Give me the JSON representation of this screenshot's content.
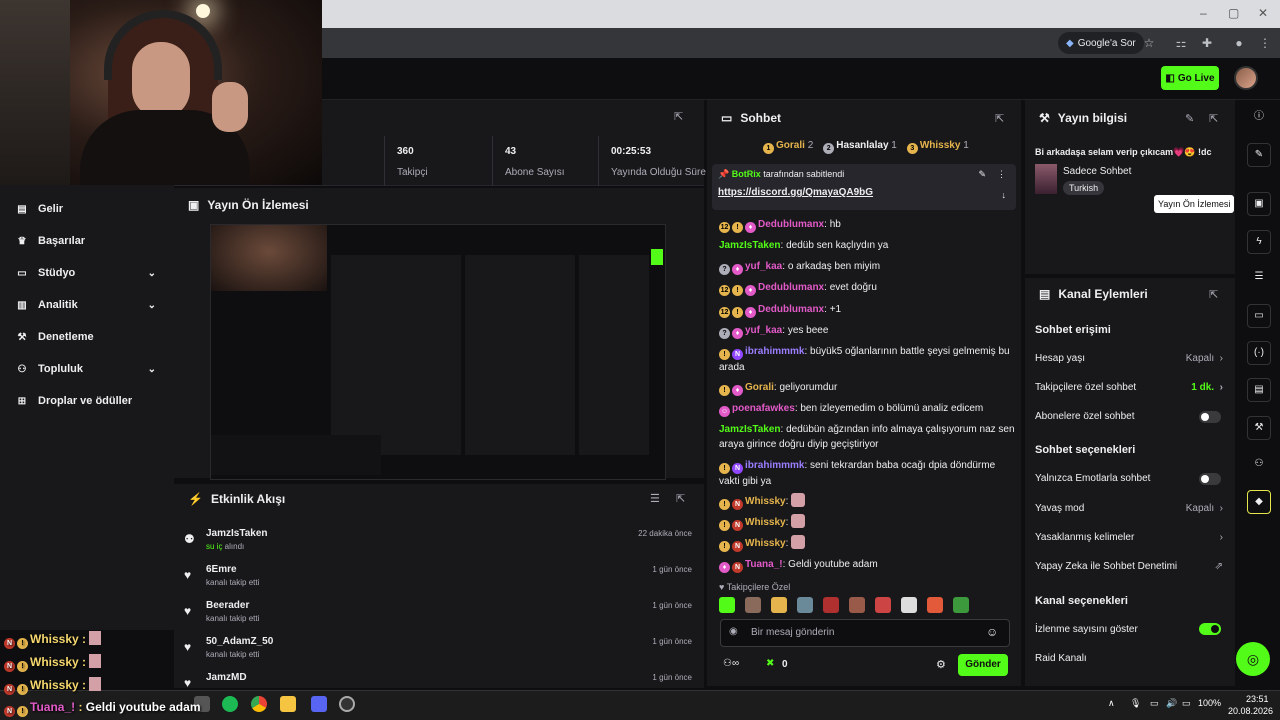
{
  "browser": {
    "google_chip": "Google'a Sor"
  },
  "header": {
    "go_live": "Go Live"
  },
  "sidebar": {
    "items": [
      {
        "label": "Gelir",
        "icon": "money-icon",
        "chevron": false
      },
      {
        "label": "Başarılar",
        "icon": "trophy-icon",
        "chevron": false
      },
      {
        "label": "Stüdyo",
        "icon": "studio-icon",
        "chevron": true
      },
      {
        "label": "Analitik",
        "icon": "chart-icon",
        "chevron": true
      },
      {
        "label": "Denetleme",
        "icon": "wrench-icon",
        "chevron": false
      },
      {
        "label": "Topluluk",
        "icon": "community-icon",
        "chevron": true
      },
      {
        "label": "Droplar ve ödüller",
        "icon": "gift-icon",
        "chevron": false
      }
    ]
  },
  "stats": [
    {
      "value": "360",
      "label": "Takipçi"
    },
    {
      "value": "43",
      "label": "Abone Sayısı"
    },
    {
      "value": "00:25:53",
      "label": "Yayında Olduğu Süre"
    }
  ],
  "preview": {
    "title": "Yayın Ön İzlemesi"
  },
  "activity": {
    "title": "Etkinlik Akışı",
    "items": [
      {
        "name": "JamzIsTaken",
        "desc_highlight": "su iç",
        "desc": " alındı",
        "time": "22 dakika önce",
        "icon": "redeem-icon"
      },
      {
        "name": "6Emre",
        "desc_highlight": "",
        "desc": "kanalı takip etti",
        "time": "1 gün önce",
        "icon": "heart-icon"
      },
      {
        "name": "Beerader",
        "desc_highlight": "",
        "desc": "kanalı takip etti",
        "time": "1 gün önce",
        "icon": "heart-icon"
      },
      {
        "name": "50_AdamZ_50",
        "desc_highlight": "",
        "desc": "kanalı takip etti",
        "time": "1 gün önce",
        "icon": "heart-icon"
      },
      {
        "name": "JamzMD",
        "desc_highlight": "",
        "desc": "",
        "time": "1 gün önce",
        "icon": "heart-icon"
      }
    ]
  },
  "chat": {
    "title": "Sohbet",
    "top_chatters": [
      {
        "rank": "1",
        "name": "Gorali",
        "count": "2"
      },
      {
        "rank": "2",
        "name": "Hasanlalay",
        "count": "1"
      },
      {
        "rank": "3",
        "name": "Whissky",
        "count": "1"
      }
    ],
    "pinned_by": "BotRix",
    "pinned_suffix": " tarafından sabitlendi",
    "pinned_link": "https://discord.gg/QmayaQA9bG",
    "messages": [
      {
        "user": "Dedublumanx",
        "color": "#e25ac7",
        "text": "hb"
      },
      {
        "user": "JamzIsTaken",
        "color": "#53fc18",
        "text": "dedüb sen kaçlıydın ya"
      },
      {
        "user": "yuf_kaa",
        "color": "#e25ac7",
        "text": "o arkadaş ben miyim"
      },
      {
        "user": "Dedublumanx",
        "color": "#e25ac7",
        "text": "evet doğru"
      },
      {
        "user": "Dedublumanx",
        "color": "#e25ac7",
        "text": "+1"
      },
      {
        "user": "yuf_kaa",
        "color": "#e25ac7",
        "text": "yes beee"
      },
      {
        "user": "ibrahimmmk",
        "color": "#9b7dff",
        "text": "büyük5 oğlanlarının battle şeysi gelmemiş bu arada"
      },
      {
        "user": "Gorali",
        "color": "#e5b44c",
        "text": "geliyorumdur"
      },
      {
        "user": "poenafawkes",
        "color": "#e25ac7",
        "text": "ben izleyemedim o bölümü analiz edicem"
      },
      {
        "user": "JamzIsTaken",
        "color": "#53fc18",
        "text": "dedübün ağzından info almaya çalışıyorum naz sen araya girince doğru diyip geçiştiriyor"
      },
      {
        "user": "ibrahimmmk",
        "color": "#9b7dff",
        "text": "seni tekrardan baba ocağı dpia döndürme vakti gibi ya"
      },
      {
        "user": "Whissky",
        "color": "#e5b44c",
        "text": ""
      },
      {
        "user": "Whissky",
        "color": "#e5b44c",
        "text": ""
      },
      {
        "user": "Whissky",
        "color": "#e5b44c",
        "text": ""
      },
      {
        "user": "Tuana_!",
        "color": "#e25ac7",
        "text": "Geldi youtube adam"
      }
    ],
    "followers_only": "Takipçilere Özel",
    "input_placeholder": "Bir mesaj gönderin",
    "points": "0",
    "send": "Gönder"
  },
  "info": {
    "title": "Yayın bilgisi",
    "stream_title": "Bi arkadaşa selam verip çıkıcam💗😍 !dc",
    "category": "Sadece Sohbet",
    "tag": "Turkish"
  },
  "actions": {
    "title": "Kanal Eylemleri",
    "sec1": "Sohbet erişimi",
    "hesap_yasi": "Hesap yaşı",
    "hesap_yasi_val": "Kapalı",
    "takipci": "Takipçilere özel sohbet",
    "takipci_val": "1 dk.",
    "abone": "Abonelere özel sohbet",
    "sec2": "Sohbet seçenekleri",
    "emote": "Yalnızca Emotlarla sohbet",
    "yavas": "Yavaş mod",
    "yavas_val": "Kapalı",
    "yasak": "Yasaklanmış kelimeler",
    "ai": "Yapay Zeka ile Sohbet Denetimi",
    "sec3": "Kanal seçenekleri",
    "izlenme": "İzlenme sayısını göster",
    "raid": "Raid Kanalı"
  },
  "tooltip": "Yayın Ön İzlemesi",
  "overlay": [
    {
      "user": "Whissky",
      "text": ""
    },
    {
      "user": "Whissky",
      "text": ""
    },
    {
      "user": "Whissky",
      "text": ""
    },
    {
      "user": "Tuana_!",
      "text": "Geldi youtube adam"
    }
  ],
  "taskbar": {
    "battery": "100%",
    "time": "23:51",
    "date": "20.08.2026"
  },
  "colors": {
    "accent": "#53fc18",
    "panel": "#18181b",
    "background": "#0e0e10"
  }
}
